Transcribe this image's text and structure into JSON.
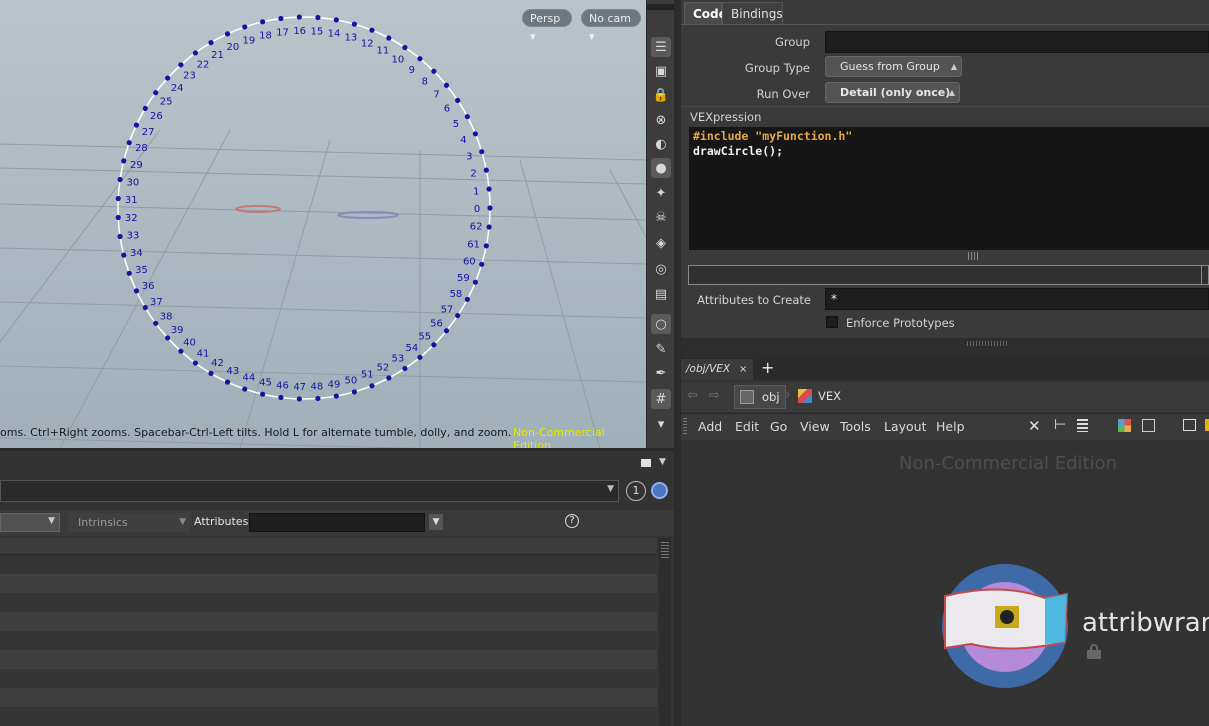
{
  "viewport": {
    "persp_label": "Persp",
    "cam_label": "No cam",
    "status_text": "oms. Ctrl+Right zooms. Spacebar-Ctrl-Left tilts. Hold L for alternate tumble, dolly, and zoom.",
    "watermark": "Non-Commercial Edition",
    "point_labels": [
      "0",
      "1",
      "2",
      "3",
      "4",
      "5",
      "6",
      "7",
      "8",
      "9",
      "10",
      "11",
      "12",
      "13",
      "14",
      "15",
      "16",
      "17",
      "18",
      "19",
      "20",
      "21",
      "22",
      "23",
      "24",
      "25",
      "26",
      "27",
      "28",
      "29",
      "30",
      "31",
      "32",
      "33",
      "34",
      "35",
      "36",
      "37",
      "38",
      "39",
      "40",
      "41",
      "42",
      "43",
      "44",
      "45",
      "46",
      "47",
      "48",
      "49",
      "50",
      "51",
      "52",
      "53",
      "54",
      "55",
      "56",
      "57",
      "58",
      "59",
      "60",
      "61",
      "62"
    ],
    "point_color": "#1414a0"
  },
  "spreadsheet": {
    "page_number": "1",
    "intrinsics_label": "Intrinsics",
    "attributes_label": "Attributes:",
    "help_icon": "question-circle-icon"
  },
  "params": {
    "tabs": [
      "Code",
      "Bindings"
    ],
    "group_label": "Group",
    "group_value": "",
    "group_type_label": "Group Type",
    "group_type_value": "Guess from Group",
    "run_over_label": "Run Over",
    "run_over_value": "Detail (only once)",
    "vexpression_label": "VEXpression",
    "code_line1": "#include \"myFunction.h\"",
    "code_line2": "drawCircle();",
    "attributes_to_create_label": "Attributes to Create",
    "attributes_to_create_value": "*",
    "enforce_prototypes_label": "Enforce Prototypes"
  },
  "network": {
    "tab_label": "/obj/VEX",
    "breadcrumb_obj": "obj",
    "breadcrumb_vex": "VEX",
    "menu": [
      "Add",
      "Edit",
      "Go",
      "View",
      "Tools",
      "Layout",
      "Help"
    ],
    "watermark": "Non-Commercial Edition",
    "node_name": "attribwrang"
  },
  "colors": {
    "code_keyword": "#e8a84a",
    "code_text": "#f2f2f2",
    "viewport_watermark": "#e8e800",
    "node_circle": "#3f6aa8",
    "node_inner": "#b58ad8"
  }
}
